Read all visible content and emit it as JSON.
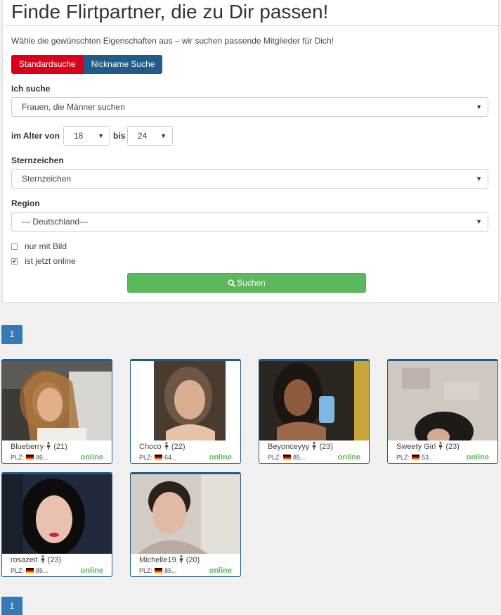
{
  "title": "Finde Flirtpartner, die zu Dir passen!",
  "intro": "Wähle die gewünschten Eigenschaften aus – wir suchen passende Mitglieder für Dich!",
  "tabs": {
    "standard": "Standardsuche",
    "nickname": "Nickname Suche"
  },
  "form": {
    "ich_suche_label": "Ich suche",
    "ich_suche_value": "Frauen, die Männer suchen",
    "alter_label": "im Alter von",
    "alter_from": "18",
    "bis_label": "bis",
    "alter_to": "24",
    "sternzeichen_label": "Sternzeichen",
    "sternzeichen_value": "Sternzeichen",
    "region_label": "Region",
    "region_value": "--- Deutschland---",
    "nur_mit_bild": "nur mit Bild",
    "nur_mit_bild_checked": false,
    "ist_online": "ist jetzt online",
    "ist_online_checked": true,
    "search_button": "Suchen"
  },
  "pager": {
    "page": "1"
  },
  "profiles": [
    {
      "name": "Blueberry",
      "age": "(21)",
      "plz_label": "PLZ:",
      "plz": "86...",
      "status": "online"
    },
    {
      "name": "Choco",
      "age": "(22)",
      "plz_label": "PLZ:",
      "plz": "64...",
      "status": "online"
    },
    {
      "name": "Beyonceyyy",
      "age": "(23)",
      "plz_label": "PLZ:",
      "plz": "85...",
      "status": "online"
    },
    {
      "name": "Sweety Girl",
      "age": "(23)",
      "plz_label": "PLZ:",
      "plz": "53...",
      "status": "online"
    },
    {
      "name": "rosazeit",
      "age": "(23)",
      "plz_label": "PLZ:",
      "plz": "85...",
      "status": "online"
    },
    {
      "name": "Michelle19",
      "age": "(20)",
      "plz_label": "PLZ:",
      "plz": "85...",
      "status": "online"
    }
  ],
  "colors": {
    "accent_red": "#d9001b",
    "accent_blue": "#1f5c87",
    "success_green": "#5cb85c",
    "pager_blue": "#337ab7"
  }
}
